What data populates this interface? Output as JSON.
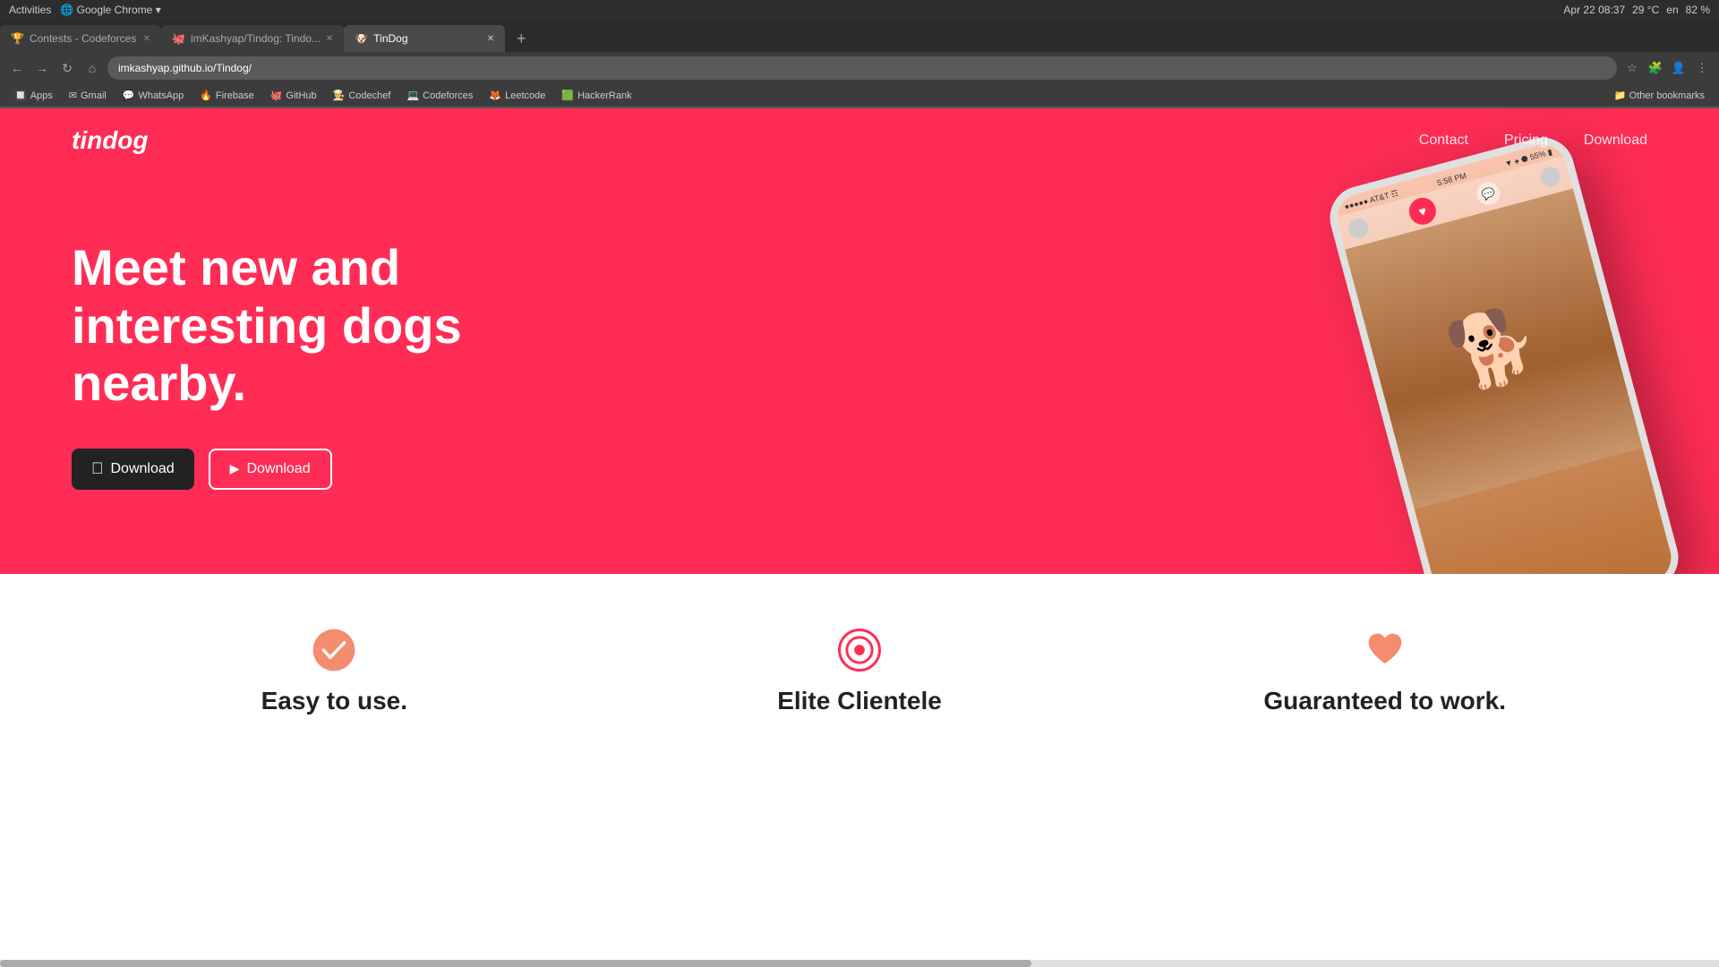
{
  "os": {
    "activities": "Activities",
    "browser": "Google Chrome",
    "datetime": "Apr 22  08:37",
    "weather": "29 °C",
    "language": "en",
    "battery": "82 %"
  },
  "tabs": [
    {
      "label": "Contests - Codeforces",
      "favicon": "🏆",
      "active": false
    },
    {
      "label": "imKashyap/Tindog: Tindo...",
      "favicon": "🐙",
      "active": false
    },
    {
      "label": "TinDog",
      "favicon": "🐶",
      "active": true
    }
  ],
  "addressbar": {
    "url": "imkashyap.github.io/Tindog/"
  },
  "bookmarks": [
    {
      "label": "Apps",
      "favicon": "🔲"
    },
    {
      "label": "Gmail",
      "favicon": "✉"
    },
    {
      "label": "WhatsApp",
      "favicon": "💬"
    },
    {
      "label": "Firebase",
      "favicon": "🔥"
    },
    {
      "label": "GitHub",
      "favicon": "🐙"
    },
    {
      "label": "Codechef",
      "favicon": "👨‍🍳"
    },
    {
      "label": "Codeforces",
      "favicon": "💻"
    },
    {
      "label": "Leetcode",
      "favicon": "🦊"
    },
    {
      "label": "HackerRank",
      "favicon": "🟩"
    },
    {
      "label": "Other bookmarks",
      "favicon": "📁"
    }
  ],
  "navbar": {
    "brand": "tindog",
    "links": [
      {
        "label": "Contact"
      },
      {
        "label": "Pricing"
      },
      {
        "label": "Download"
      }
    ]
  },
  "hero": {
    "heading": "Meet new and interesting dogs nearby.",
    "buttons": [
      {
        "label": "Download",
        "icon": "apple",
        "platform": "apple"
      },
      {
        "label": "Download",
        "icon": "play",
        "platform": "google"
      }
    ]
  },
  "features": [
    {
      "icon": "check",
      "title": "Easy to use.",
      "icon_type": "check"
    },
    {
      "icon": "target",
      "title": "Elite Clientele",
      "icon_type": "target"
    },
    {
      "icon": "heart",
      "title": "Guaranteed to work.",
      "icon_type": "heart"
    }
  ],
  "colors": {
    "hero_bg": "#ff2d55",
    "btn_dark": "#222222",
    "feature_icon_salmon": "#f48c6e"
  }
}
